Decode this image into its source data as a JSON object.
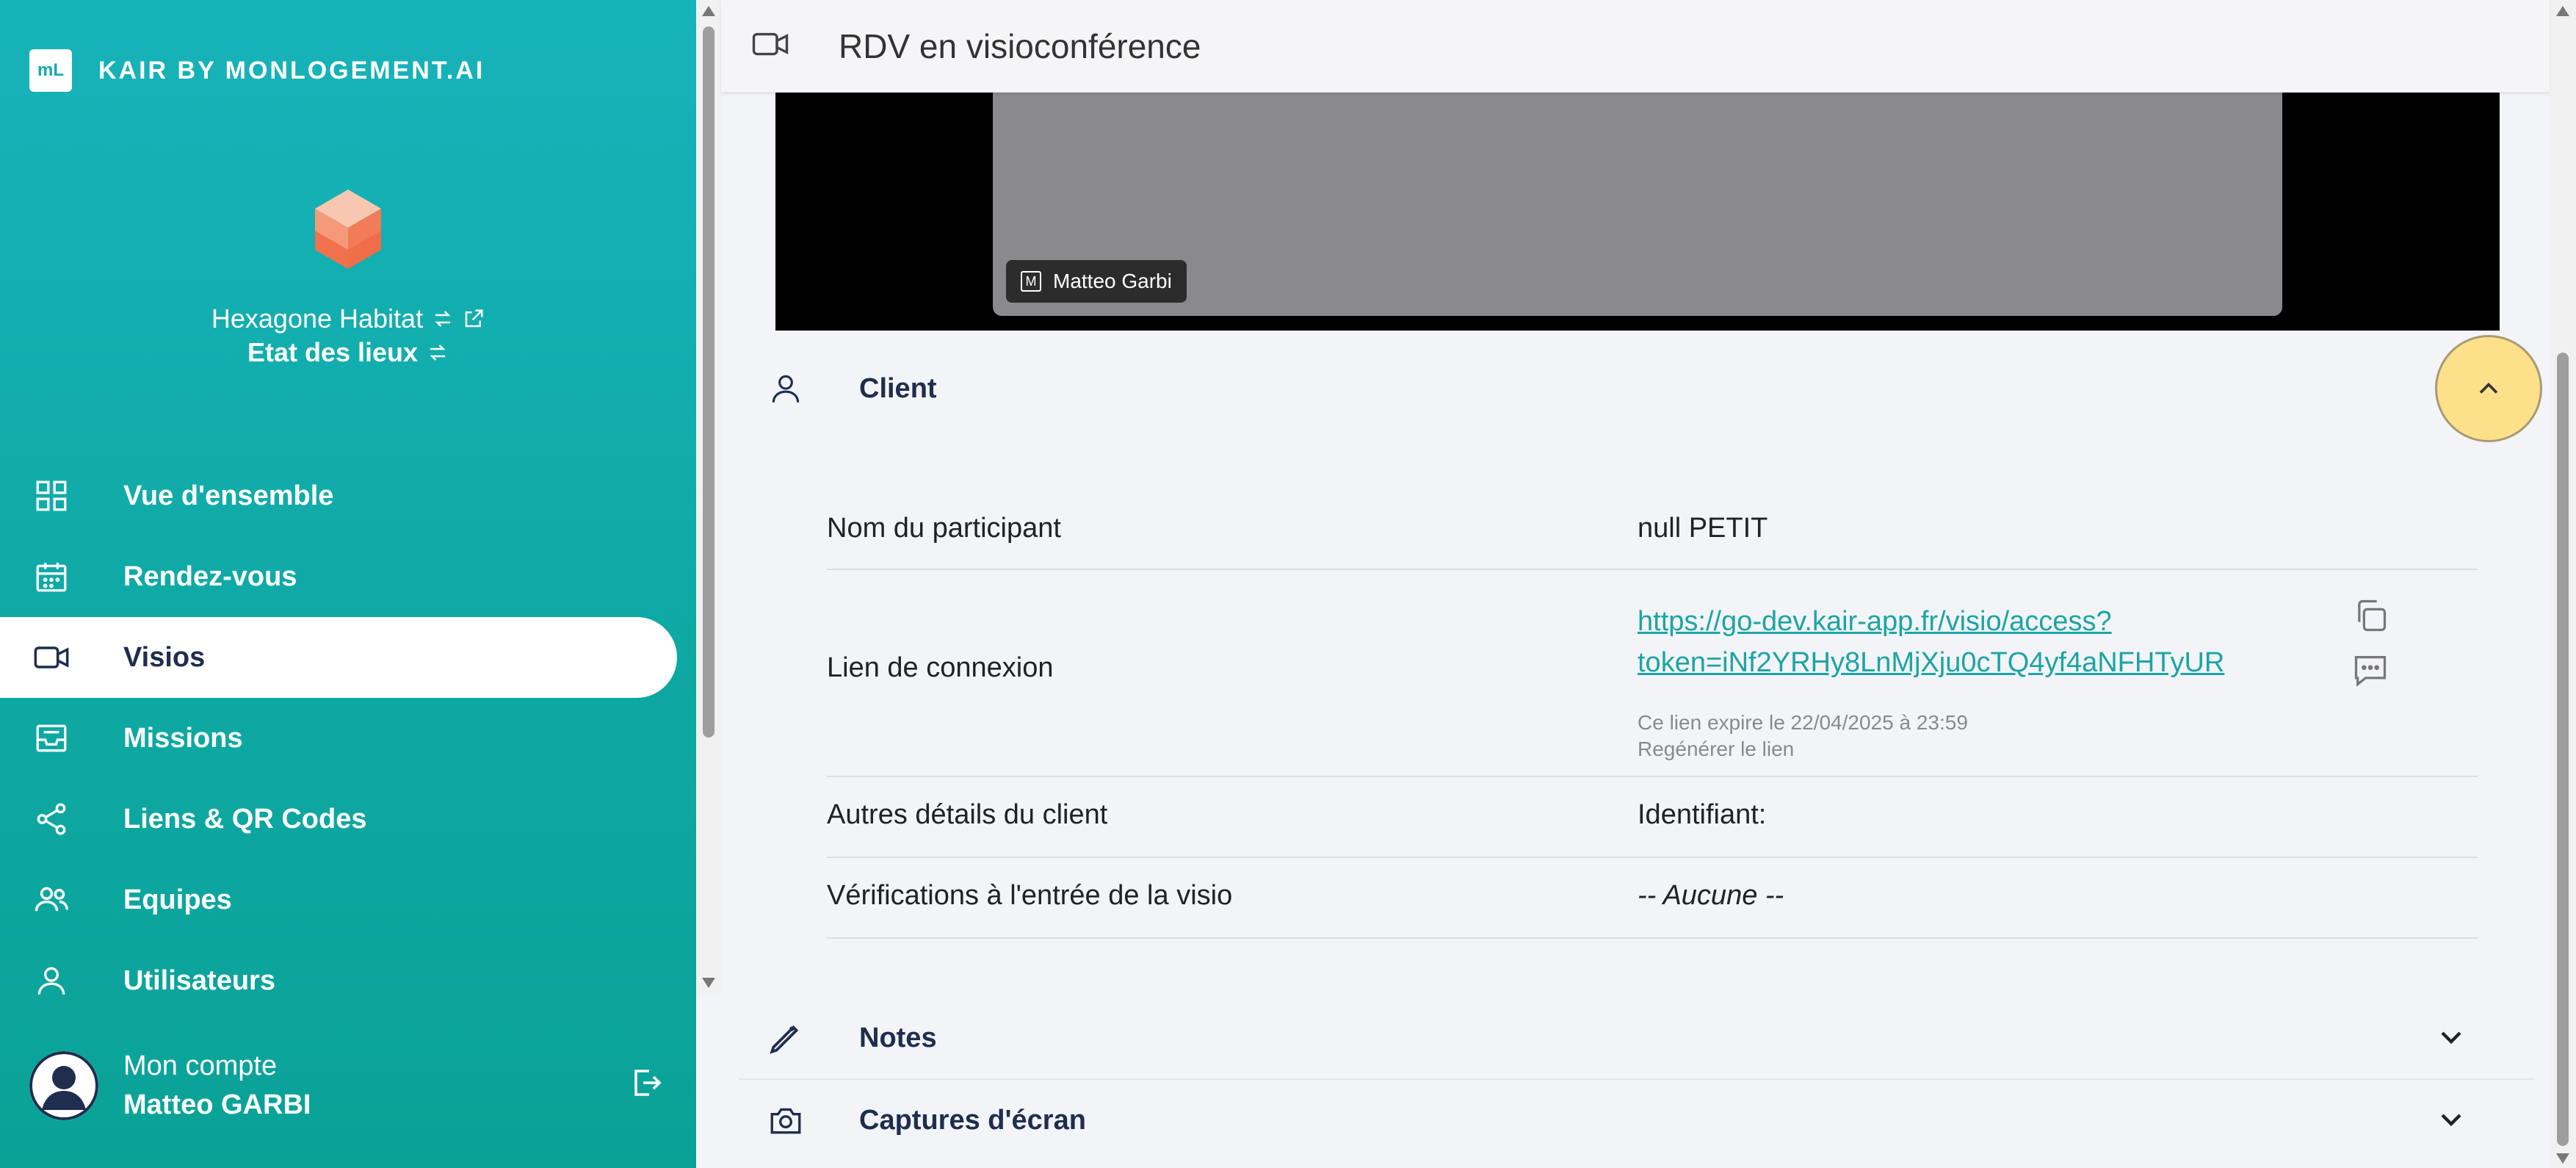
{
  "brand": {
    "logo_text": "mL",
    "name": "KAIR BY MONLOGEMENT.AI"
  },
  "org": {
    "company": "Hexagone Habitat",
    "mode": "Etat des lieux"
  },
  "nav": {
    "items": [
      {
        "label": "Vue d'ensemble",
        "icon": "grid-icon"
      },
      {
        "label": "Rendez-vous",
        "icon": "calendar-icon"
      },
      {
        "label": "Visios",
        "icon": "video-icon",
        "active": true
      },
      {
        "label": "Missions",
        "icon": "inbox-icon"
      },
      {
        "label": "Liens & QR Codes",
        "icon": "share-icon"
      },
      {
        "label": "Equipes",
        "icon": "team-icon"
      },
      {
        "label": "Utilisateurs",
        "icon": "user-icon"
      }
    ]
  },
  "account": {
    "label": "Mon compte",
    "name": "Matteo GARBI"
  },
  "header": {
    "title": "RDV en visioconférence"
  },
  "video": {
    "participant_badge": "M",
    "participant_name": "Matteo Garbi"
  },
  "client_section": {
    "title": "Client",
    "rows": {
      "participant_label": "Nom du participant",
      "participant_value": "null PETIT",
      "link_label": "Lien de connexion",
      "link_line1": "https://go-dev.kair-app.fr/visio/access?",
      "link_line2": "token=iNf2YRHy8LnMjXju0cTQ4yf4aNFHTyUR",
      "link_expiry": "Ce lien expire le 22/04/2025 à 23:59",
      "link_regenerate": "Regénérer le lien",
      "details_label": "Autres détails du client",
      "details_value": "Identifiant:",
      "checks_label": "Vérifications à l'entrée de la visio",
      "checks_value": "-- Aucune --"
    }
  },
  "notes_section": {
    "title": "Notes"
  },
  "captures_section": {
    "title": "Captures d'écran"
  },
  "colors": {
    "sidebar": "#13aab2",
    "accent_link": "#1ba5a4",
    "collapse_button": "#fde08a",
    "nav_active_text": "#1f2d4f"
  }
}
